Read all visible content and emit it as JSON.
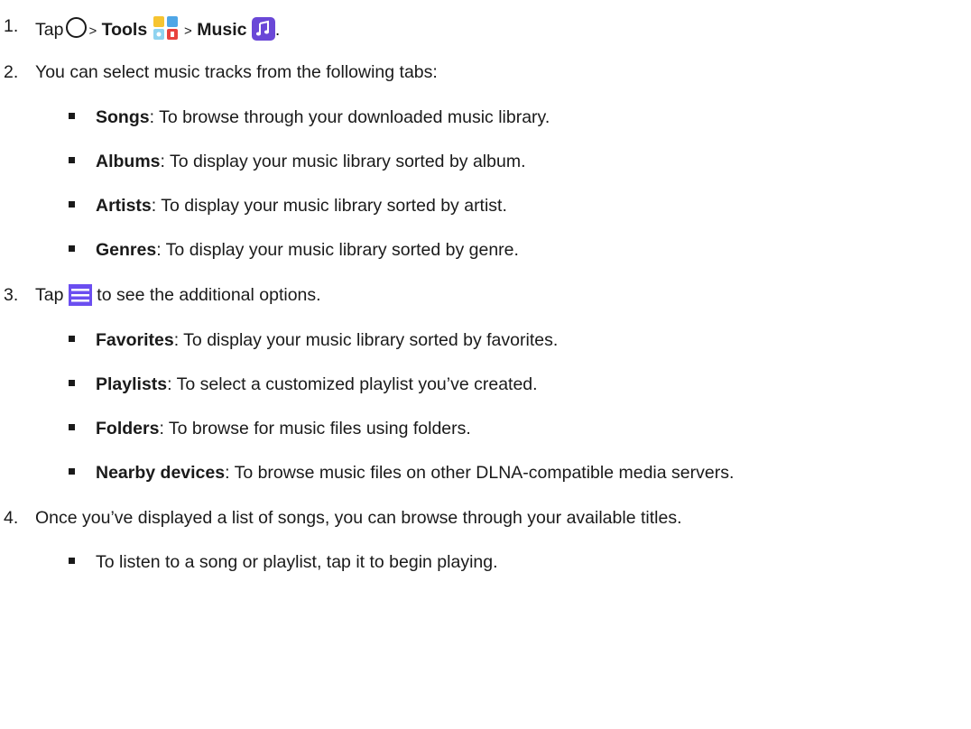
{
  "steps": [
    {
      "number": "1.",
      "tap_label": "Tap",
      "arrow1": ">",
      "tools_label": "Tools",
      "arrow2": ">",
      "music_label": "Music",
      "end_period": "."
    },
    {
      "number": "2.",
      "text": "You can select music tracks from the following tabs:",
      "items": [
        {
          "label": "Songs",
          "text": ": To browse through your downloaded music library."
        },
        {
          "label": "Albums",
          "text": ": To display your music library sorted by album."
        },
        {
          "label": "Artists",
          "text": ": To display your music library sorted by artist."
        },
        {
          "label": "Genres",
          "text": ": To display your music library sorted by genre."
        }
      ]
    },
    {
      "number": "3.",
      "tap_label": "Tap",
      "text_after_icon": " to see the additional options.",
      "items": [
        {
          "label": "Favorites",
          "text": ": To display your music library sorted by favorites."
        },
        {
          "label": "Playlists",
          "text": ": To select a customized playlist you’ve created."
        },
        {
          "label": "Folders",
          "text": ": To browse for music files using folders."
        },
        {
          "label": "Nearby devices",
          "text": ": To browse music files on other DLNA-compatible media servers."
        }
      ]
    },
    {
      "number": "4.",
      "text": "Once you’ve displayed a list of songs, you can browse through your available titles.",
      "items": [
        {
          "text": "To listen to a song or playlist, tap it to begin playing."
        }
      ]
    }
  ],
  "icons": {
    "home": "home-circle-icon",
    "tools": "tools-app-icon",
    "music": "music-note-app-icon",
    "menu": "menu-hamburger-icon"
  },
  "colors": {
    "text": "#1a1a1a",
    "music_icon": "#6a48d7",
    "menu_icon": "#6b4ef0"
  }
}
